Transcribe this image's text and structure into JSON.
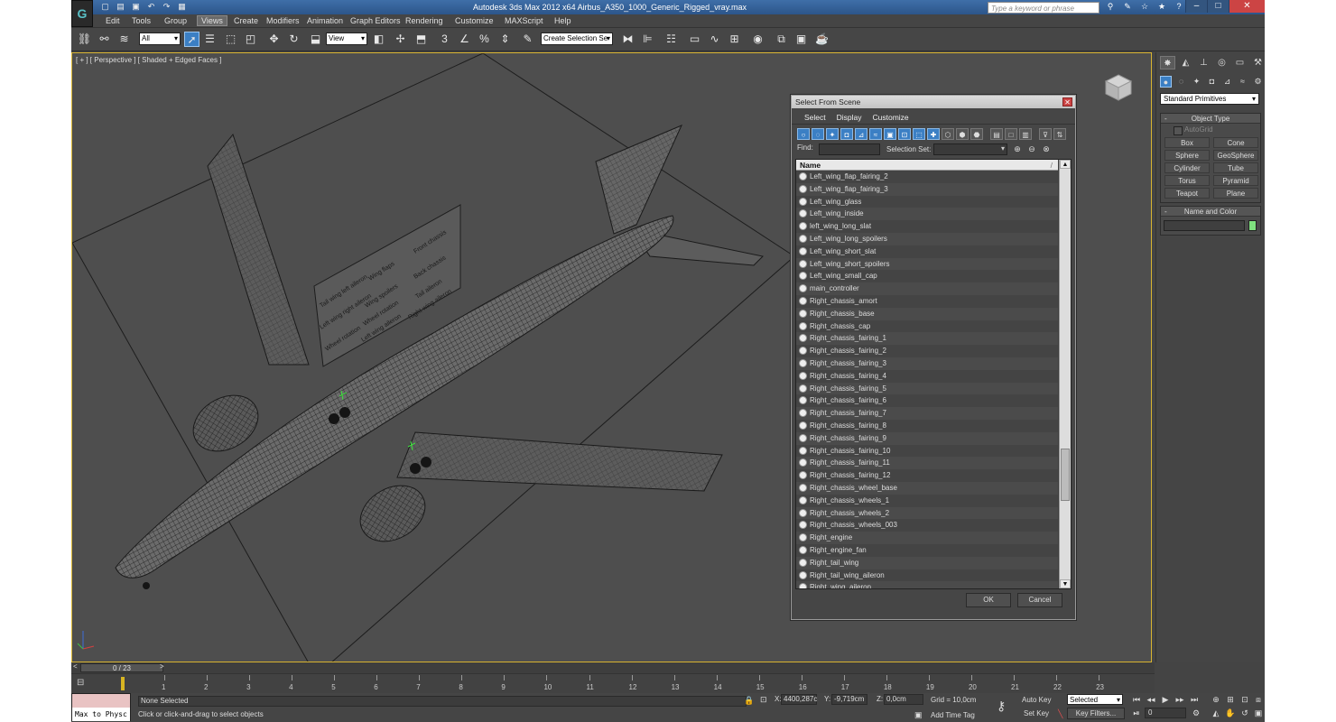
{
  "title": "Autodesk 3ds Max  2012 x64      Airbus_A350_1000_Generic_Rigged_vray.max",
  "help_search_placeholder": "Type a keyword or phrase",
  "menu": [
    "Edit",
    "Tools",
    "Group",
    "Views",
    "Create",
    "Modifiers",
    "Animation",
    "Graph Editors",
    "Rendering",
    "Customize",
    "MAXScript",
    "Help"
  ],
  "toolbar": {
    "filter_value": "All",
    "refcoord_value": "View",
    "named_selection": "Create Selection Se",
    "snap_label": "3"
  },
  "viewport": {
    "label": "[ + ] [ Perspective ] [ Shaded + Edged Faces ]"
  },
  "panel_texts": [
    "Tail wing left aileron",
    "Wing flaps",
    "Front chassis",
    "Left wing right aileron",
    "Wing spoilers",
    "Back chassis",
    "Wheel rotation",
    "Wheel rotation",
    "Tail aileron",
    "Left wing aileron",
    "Right wing aileron"
  ],
  "command_panel": {
    "dropdown": "Standard Primitives",
    "object_type_title": "Object Type",
    "autogrid": "AutoGrid",
    "buttons": [
      "Box",
      "Cone",
      "Sphere",
      "GeoSphere",
      "Cylinder",
      "Tube",
      "Torus",
      "Pyramid",
      "Teapot",
      "Plane"
    ],
    "name_color_title": "Name and Color",
    "swatch_color": "#7fe27f"
  },
  "dialog": {
    "title": "Select From Scene",
    "menu": [
      "Select",
      "Display",
      "Customize"
    ],
    "find_label": "Find:",
    "selection_set_label": "Selection Set:",
    "column_header": "Name",
    "rows": [
      "Left_wing_flap_fairing_2",
      "Left_wing_flap_fairing_3",
      "Left_wing_glass",
      "Left_wing_inside",
      "left_wing_long_slat",
      "Left_wing_long_spoilers",
      "Left_wing_short_slat",
      "Left_wing_short_spoilers",
      "Left_wing_small_cap",
      "main_controller",
      "Right_chassis_amort",
      "Right_chassis_base",
      "Right_chassis_cap",
      "Right_chassis_fairing_1",
      "Right_chassis_fairing_2",
      "Right_chassis_fairing_3",
      "Right_chassis_fairing_4",
      "Right_chassis_fairing_5",
      "Right_chassis_fairing_6",
      "Right_chassis_fairing_7",
      "Right_chassis_fairing_8",
      "Right_chassis_fairing_9",
      "Right_chassis_fairing_10",
      "Right_chassis_fairing_11",
      "Right_chassis_fairing_12",
      "Right_chassis_wheel_base",
      "Right_chassis_wheels_1",
      "Right_chassis_wheels_2",
      "Right_chassis_wheels_003",
      "Right_engine",
      "Right_engine_fan",
      "Right_tail_wing",
      "Right_tail_wing_aileron",
      "Right_wing_aileron"
    ],
    "ok": "OK",
    "cancel": "Cancel"
  },
  "timeline": {
    "slider": "0 / 23",
    "ticks": [
      "1",
      "2",
      "3",
      "4",
      "5",
      "6",
      "7",
      "8",
      "9",
      "10",
      "11",
      "12",
      "13",
      "14",
      "15",
      "16",
      "17",
      "18",
      "19",
      "20",
      "21",
      "22",
      "23"
    ]
  },
  "status": {
    "listener": "Max to Physc",
    "selection": "None Selected",
    "prompt": "Click or click-and-drag to select objects",
    "x_label": "X:",
    "x_value": "4400,287c",
    "y_label": "Y:",
    "y_value": "-9,719cm",
    "z_label": "Z:",
    "z_value": "0,0cm",
    "grid": "Grid = 10,0cm",
    "add_time_tag": "Add Time Tag",
    "auto_key": "Auto Key",
    "set_key": "Set Key",
    "key_mode": "Selected",
    "key_filters": "Key Filters...",
    "frame": "0"
  }
}
